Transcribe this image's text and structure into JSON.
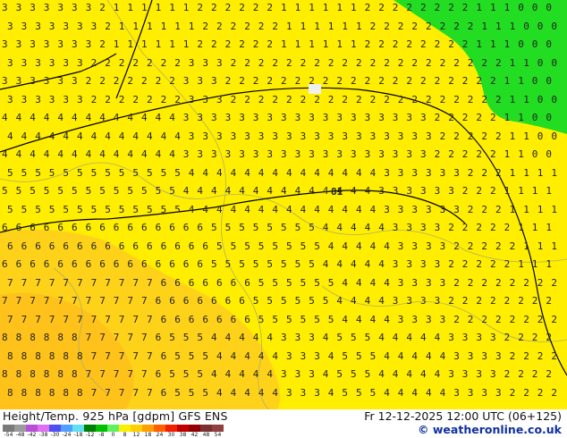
{
  "map": {
    "contour_label": "81",
    "values_note_rows": [
      "3 3 3 3 3 3 2 1 1 1 1 1 1 2 2 2 2 2 2 1 1 1 1 1 1 2 2 2 2 2 2 2 2 1 1 1 0 0 0",
      "3 3 3 3 3 2 2 2 2 2 2 3 3 3 2 2 2 2 2 2 2 2 2 2 2 2 2 2 2 2 2 2 1 1 0 0",
      "4 4 4 4 4 4 4 4 4 4 4 3 3 3 3 3 3 3 3 3 3 3 3 3 3 3 3 2 2 2 2 1 1 0 0",
      "5 5 5 5 5 5 5 5 5 5 4 4 4 4 4 4 4 4 4 4 4 4 3 3 3 3 3 2 2 1 1 1 1",
      "6 6 6 6 6 6 6 6 6 6 6 6 5 5 5 5 5 5 4 4 4 4 3 3 3 2 2 2 2 1 1 1",
      "7 7 7 7 7 7 7 7 6 6 6 6 6 5 5 5 5 5 4 4 4 3 3 3 2 2 2 2 2 2",
      "8 8 8 8 7 7 7 7 6 5 5 4 4 4 4 3 3 4 5 5 4 4 4 4 3 3 3 2 2 2"
    ]
  },
  "footer": {
    "title": "Height/Temp. 925 hPa [gdpm] GFS ENS",
    "datetime": "Fr 12-12-2025 12:00 UTC (06+125)",
    "credit": "© weatheronline.co.uk",
    "scale_ticks": [
      "-54",
      "-48",
      "-42",
      "-38",
      "-30",
      "-24",
      "-18",
      "-12",
      "-8",
      "0",
      "8",
      "12",
      "18",
      "24",
      "30",
      "38",
      "42",
      "48",
      "54"
    ],
    "scale_colors": [
      "#7a7a7a",
      "#9b9b9b",
      "#b84fd8",
      "#e070f0",
      "#5050f0",
      "#50a0ff",
      "#60e0f0",
      "#008000",
      "#00c000",
      "#60f060",
      "#f8f000",
      "#ffd000",
      "#ffa000",
      "#ff6000",
      "#f02000",
      "#c00000",
      "#900000",
      "#7a3030",
      "#904040"
    ]
  }
}
